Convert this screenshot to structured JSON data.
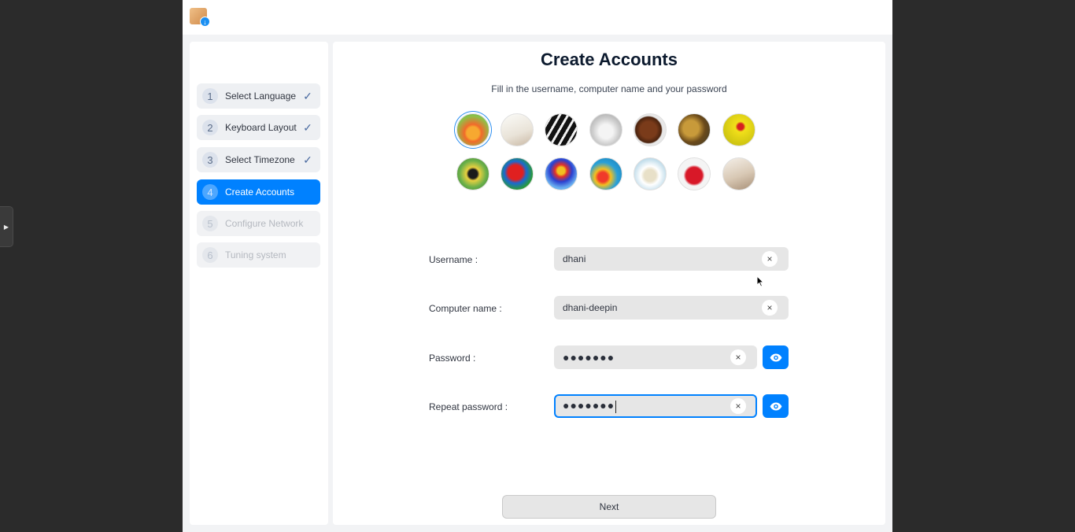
{
  "steps": [
    {
      "num": "1",
      "label": "Select Language",
      "state": "done",
      "check": "✓"
    },
    {
      "num": "2",
      "label": "Keyboard Layout",
      "state": "done",
      "check": "✓"
    },
    {
      "num": "3",
      "label": "Select Timezone",
      "state": "done",
      "check": "✓"
    },
    {
      "num": "4",
      "label": "Create Accounts",
      "state": "active",
      "check": ""
    },
    {
      "num": "5",
      "label": "Configure Network",
      "state": "disabled",
      "check": ""
    },
    {
      "num": "6",
      "label": "Tuning system",
      "state": "disabled",
      "check": ""
    }
  ],
  "main": {
    "title": "Create Accounts",
    "subtitle": "Fill in the username, computer name and your password"
  },
  "avatars": [
    {
      "name": "flower",
      "selected": true
    },
    {
      "name": "notebook"
    },
    {
      "name": "piano"
    },
    {
      "name": "kitten"
    },
    {
      "name": "horse"
    },
    {
      "name": "leopard"
    },
    {
      "name": "ladybugs"
    },
    {
      "name": "butterfly"
    },
    {
      "name": "parrot"
    },
    {
      "name": "hot-air-balloon"
    },
    {
      "name": "balloons"
    },
    {
      "name": "rings"
    },
    {
      "name": "heart"
    },
    {
      "name": "room"
    }
  ],
  "form": {
    "username_label": "Username :",
    "username_value": "dhani",
    "computer_label": "Computer name :",
    "computer_value": "dhani-deepin",
    "password_label": "Password :",
    "password_value": "●●●●●●●",
    "repeat_label": "Repeat password :",
    "repeat_value": "●●●●●●●",
    "clear_icon": "×"
  },
  "next_label": "Next",
  "colors": {
    "accent": "#0081ff",
    "window_bg": "#f2f3f5",
    "desktop": "#2b2b2b"
  }
}
